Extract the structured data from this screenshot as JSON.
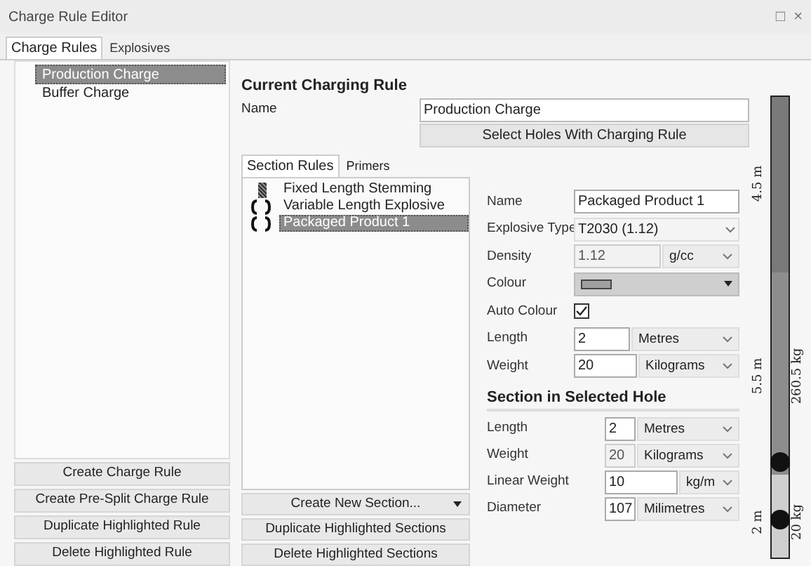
{
  "window": {
    "title": "Charge Rule Editor",
    "controls": [
      "□",
      "×"
    ]
  },
  "tabs": [
    {
      "label": "Charge Rules",
      "selected": true
    },
    {
      "label": "Explosives",
      "selected": false
    }
  ],
  "rules": [
    {
      "label": "Production Charge",
      "selected": true
    },
    {
      "label": "Buffer Charge",
      "selected": false
    }
  ],
  "rule_buttons": [
    "Create Charge Rule",
    "Create Pre-Split Charge Rule",
    "Duplicate Highlighted Rule",
    "Delete Highlighted Rule"
  ],
  "current_rule": {
    "heading": "Current Charging Rule",
    "name_label": "Name",
    "name_value": "Production Charge",
    "select_button": "Select Holes With Charging Rule"
  },
  "section_tabs": [
    {
      "label": "Section Rules",
      "selected": true
    },
    {
      "label": "Primers",
      "selected": false
    }
  ],
  "sections": [
    {
      "label": "Fixed Length Stemming",
      "kind": "stemming",
      "selected": false
    },
    {
      "label": "Variable Length Explosive",
      "kind": "explosive",
      "selected": false
    },
    {
      "label": "Packaged Product 1",
      "kind": "explosive",
      "selected": true
    }
  ],
  "section_buttons": [
    {
      "label": "Create New Section...",
      "dropdown": true
    },
    {
      "label": "Duplicate Highlighted Sections",
      "dropdown": false
    },
    {
      "label": "Delete Highlighted Sections",
      "dropdown": false
    }
  ],
  "section_form": [
    {
      "kind": "text",
      "label": "Name",
      "value": "Packaged Product 1"
    },
    {
      "kind": "select",
      "label": "Explosive Type",
      "value": "T2030 (1.12)"
    },
    {
      "kind": "unit",
      "label": "Density",
      "value": "1.12",
      "unit": "g/cc",
      "disabled": true
    },
    {
      "kind": "colour",
      "label": "Colour",
      "color": "#a0a0a0"
    },
    {
      "kind": "check",
      "label": "Auto Colour",
      "checked": true
    },
    {
      "kind": "unit",
      "label": "Length",
      "value": "2",
      "unit": "Metres",
      "disabled": false
    },
    {
      "kind": "unit",
      "label": "Weight",
      "value": "20",
      "unit": "Kilograms",
      "disabled": false
    }
  ],
  "hole_section": {
    "heading": "Section in Selected Hole",
    "fields": [
      {
        "label": "Length",
        "value": "2",
        "unit": "Metres",
        "disabled": false
      },
      {
        "label": "Weight",
        "value": "20",
        "unit": "Kilograms",
        "disabled": true
      },
      {
        "label": "Linear Weight",
        "value": "10",
        "unit": "kg/m",
        "disabled": false
      },
      {
        "label": "Diameter",
        "value": "107",
        "unit": "Milimetres",
        "disabled": false
      }
    ]
  },
  "hole_column": {
    "segments": [
      {
        "kind": "stemming",
        "level": 0.38,
        "length_label": "4.5 m"
      },
      {
        "kind": "explosive",
        "level": 0.44,
        "length_label": "5.5 m",
        "weight_label": "260.5 kg"
      },
      {
        "kind": "packaged",
        "level": 0.18,
        "length_label": "2 m",
        "weight_label": "20 kg"
      }
    ]
  }
}
